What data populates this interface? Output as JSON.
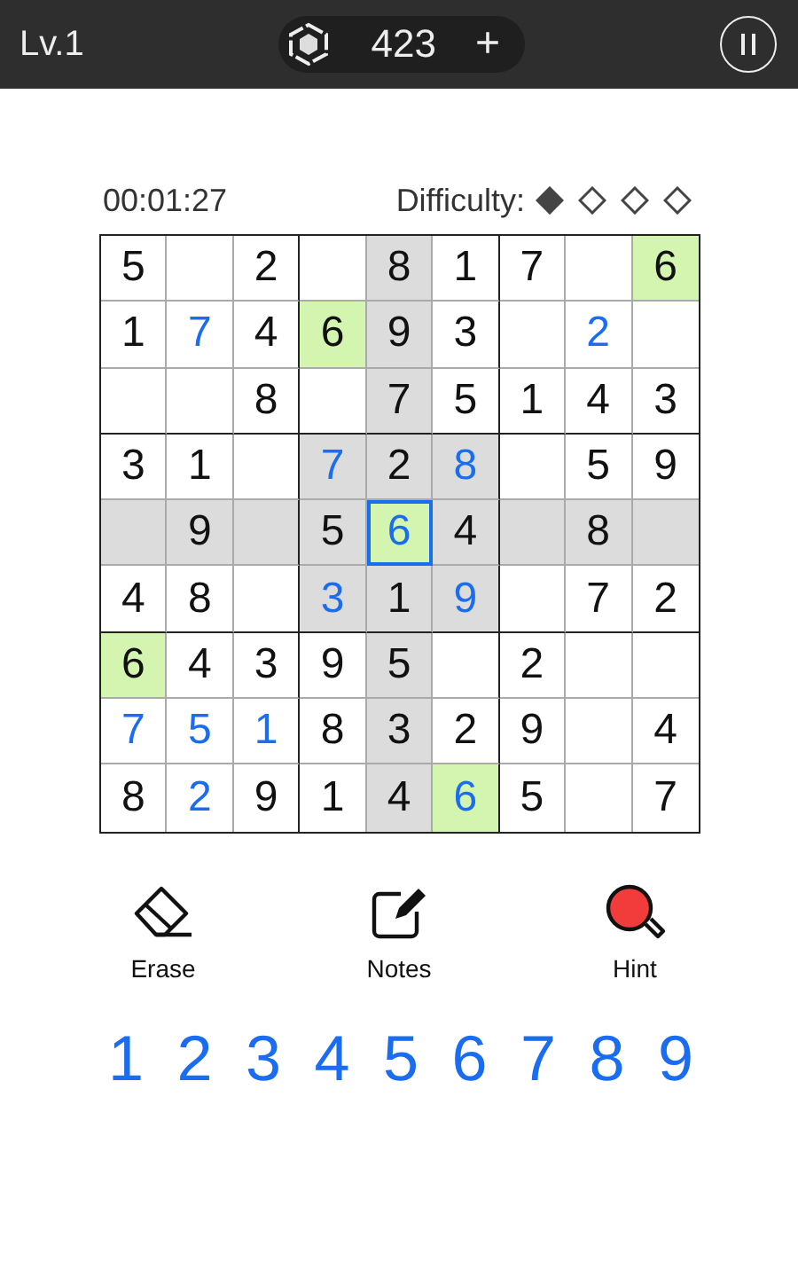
{
  "top_bar": {
    "level": "Lv.1",
    "coins": "423",
    "add": "+"
  },
  "timer": "00:01:27",
  "difficulty": {
    "label": "Difficulty:",
    "marks": [
      {
        "filled": true
      },
      {
        "filled": false
      },
      {
        "filled": false
      },
      {
        "filled": false
      }
    ]
  },
  "grid": [
    [
      {
        "v": "5",
        "entered": false,
        "highlighted": false,
        "matching": false,
        "selected": false
      },
      {
        "highlighted": false,
        "matching": false,
        "selected": false
      },
      {
        "v": "2",
        "entered": false,
        "highlighted": false,
        "matching": false,
        "selected": false
      },
      {
        "highlighted": false,
        "matching": false,
        "selected": false
      },
      {
        "v": "8",
        "entered": false,
        "highlighted": true,
        "matching": false,
        "selected": false
      },
      {
        "v": "1",
        "entered": false,
        "highlighted": false,
        "matching": false,
        "selected": false
      },
      {
        "v": "7",
        "entered": false,
        "highlighted": false,
        "matching": false,
        "selected": false
      },
      {
        "highlighted": false,
        "matching": false,
        "selected": false
      },
      {
        "v": "6",
        "entered": false,
        "matching": true,
        "selected": false
      }
    ],
    [
      {
        "v": "1",
        "entered": false,
        "highlighted": false,
        "matching": false,
        "selected": false
      },
      {
        "v": "7",
        "entered": true,
        "highlighted": false,
        "matching": false,
        "selected": false
      },
      {
        "v": "4",
        "entered": false,
        "highlighted": false,
        "matching": false,
        "selected": false
      },
      {
        "v": "6",
        "entered": false,
        "matching": true,
        "selected": false
      },
      {
        "v": "9",
        "entered": false,
        "highlighted": true,
        "matching": false,
        "selected": false
      },
      {
        "v": "3",
        "entered": false,
        "highlighted": false,
        "matching": false,
        "selected": false
      },
      {
        "highlighted": false,
        "matching": false,
        "selected": false
      },
      {
        "v": "2",
        "entered": true,
        "highlighted": false,
        "matching": false,
        "selected": false
      },
      {
        "highlighted": false,
        "matching": false,
        "selected": false
      }
    ],
    [
      {
        "highlighted": false,
        "matching": false,
        "selected": false
      },
      {
        "highlighted": false,
        "matching": false,
        "selected": false
      },
      {
        "v": "8",
        "entered": false,
        "highlighted": false,
        "matching": false,
        "selected": false
      },
      {
        "highlighted": false,
        "matching": false,
        "selected": false
      },
      {
        "v": "7",
        "entered": false,
        "highlighted": true,
        "matching": false,
        "selected": false
      },
      {
        "v": "5",
        "entered": false,
        "highlighted": false,
        "matching": false,
        "selected": false
      },
      {
        "v": "1",
        "entered": false,
        "highlighted": false,
        "matching": false,
        "selected": false
      },
      {
        "v": "4",
        "entered": false,
        "highlighted": false,
        "matching": false,
        "selected": false
      },
      {
        "v": "3",
        "entered": false,
        "highlighted": false,
        "matching": false,
        "selected": false
      }
    ],
    [
      {
        "v": "3",
        "entered": false,
        "highlighted": false,
        "matching": false,
        "selected": false
      },
      {
        "v": "1",
        "entered": false,
        "highlighted": false,
        "matching": false,
        "selected": false
      },
      {
        "highlighted": false,
        "matching": false,
        "selected": false
      },
      {
        "v": "7",
        "entered": true,
        "highlighted": true,
        "matching": false,
        "selected": false
      },
      {
        "v": "2",
        "entered": false,
        "highlighted": true,
        "matching": false,
        "selected": false
      },
      {
        "v": "8",
        "entered": true,
        "highlighted": true,
        "matching": false,
        "selected": false
      },
      {
        "highlighted": false,
        "matching": false,
        "selected": false
      },
      {
        "v": "5",
        "entered": false,
        "highlighted": false,
        "matching": false,
        "selected": false
      },
      {
        "v": "9",
        "entered": false,
        "highlighted": false,
        "matching": false,
        "selected": false
      }
    ],
    [
      {
        "highlighted": true,
        "matching": false,
        "selected": false
      },
      {
        "v": "9",
        "entered": false,
        "highlighted": true,
        "matching": false,
        "selected": false
      },
      {
        "highlighted": true,
        "matching": false,
        "selected": false
      },
      {
        "v": "5",
        "entered": false,
        "highlighted": true,
        "matching": false,
        "selected": false
      },
      {
        "v": "6",
        "entered": true,
        "matching": true,
        "selected": true
      },
      {
        "v": "4",
        "entered": false,
        "highlighted": true,
        "matching": false,
        "selected": false
      },
      {
        "highlighted": true,
        "matching": false,
        "selected": false
      },
      {
        "v": "8",
        "entered": false,
        "highlighted": true,
        "matching": false,
        "selected": false
      },
      {
        "highlighted": true,
        "matching": false,
        "selected": false
      }
    ],
    [
      {
        "v": "4",
        "entered": false,
        "highlighted": false,
        "matching": false,
        "selected": false
      },
      {
        "v": "8",
        "entered": false,
        "highlighted": false,
        "matching": false,
        "selected": false
      },
      {
        "highlighted": false,
        "matching": false,
        "selected": false
      },
      {
        "v": "3",
        "entered": true,
        "highlighted": true,
        "matching": false,
        "selected": false
      },
      {
        "v": "1",
        "entered": false,
        "highlighted": true,
        "matching": false,
        "selected": false
      },
      {
        "v": "9",
        "entered": true,
        "highlighted": true,
        "matching": false,
        "selected": false
      },
      {
        "highlighted": false,
        "matching": false,
        "selected": false
      },
      {
        "v": "7",
        "entered": false,
        "highlighted": false,
        "matching": false,
        "selected": false
      },
      {
        "v": "2",
        "entered": false,
        "highlighted": false,
        "matching": false,
        "selected": false
      }
    ],
    [
      {
        "v": "6",
        "entered": false,
        "matching": true,
        "selected": false
      },
      {
        "v": "4",
        "entered": false,
        "highlighted": false,
        "matching": false,
        "selected": false
      },
      {
        "v": "3",
        "entered": false,
        "highlighted": false,
        "matching": false,
        "selected": false
      },
      {
        "v": "9",
        "entered": false,
        "highlighted": false,
        "matching": false,
        "selected": false
      },
      {
        "v": "5",
        "entered": false,
        "highlighted": true,
        "matching": false,
        "selected": false
      },
      {
        "highlighted": false,
        "matching": false,
        "selected": false
      },
      {
        "v": "2",
        "entered": false,
        "highlighted": false,
        "matching": false,
        "selected": false
      },
      {
        "highlighted": false,
        "matching": false,
        "selected": false
      },
      {
        "highlighted": false,
        "matching": false,
        "selected": false
      }
    ],
    [
      {
        "v": "7",
        "entered": true,
        "highlighted": false,
        "matching": false,
        "selected": false
      },
      {
        "v": "5",
        "entered": true,
        "highlighted": false,
        "matching": false,
        "selected": false
      },
      {
        "v": "1",
        "entered": true,
        "highlighted": false,
        "matching": false,
        "selected": false
      },
      {
        "v": "8",
        "entered": false,
        "highlighted": false,
        "matching": false,
        "selected": false
      },
      {
        "v": "3",
        "entered": false,
        "highlighted": true,
        "matching": false,
        "selected": false
      },
      {
        "v": "2",
        "entered": false,
        "highlighted": false,
        "matching": false,
        "selected": false
      },
      {
        "v": "9",
        "entered": false,
        "highlighted": false,
        "matching": false,
        "selected": false
      },
      {
        "highlighted": false,
        "matching": false,
        "selected": false
      },
      {
        "v": "4",
        "entered": false,
        "highlighted": false,
        "matching": false,
        "selected": false
      }
    ],
    [
      {
        "v": "8",
        "entered": false,
        "highlighted": false,
        "matching": false,
        "selected": false
      },
      {
        "v": "2",
        "entered": true,
        "highlighted": false,
        "matching": false,
        "selected": false
      },
      {
        "v": "9",
        "entered": false,
        "highlighted": false,
        "matching": false,
        "selected": false
      },
      {
        "v": "1",
        "entered": false,
        "highlighted": false,
        "matching": false,
        "selected": false
      },
      {
        "v": "4",
        "entered": false,
        "highlighted": true,
        "matching": false,
        "selected": false
      },
      {
        "v": "6",
        "entered": true,
        "matching": true,
        "selected": false
      },
      {
        "v": "5",
        "entered": false,
        "highlighted": false,
        "matching": false,
        "selected": false
      },
      {
        "highlighted": false,
        "matching": false,
        "selected": false
      },
      {
        "v": "7",
        "entered": false,
        "highlighted": false,
        "matching": false,
        "selected": false
      }
    ]
  ],
  "tools": [
    {
      "kind": "erase",
      "label": "Erase"
    },
    {
      "kind": "notes",
      "label": "Notes"
    },
    {
      "kind": "hint",
      "label": "Hint"
    }
  ],
  "number_pad": [
    "1",
    "2",
    "3",
    "4",
    "5",
    "6",
    "7",
    "8",
    "9"
  ]
}
